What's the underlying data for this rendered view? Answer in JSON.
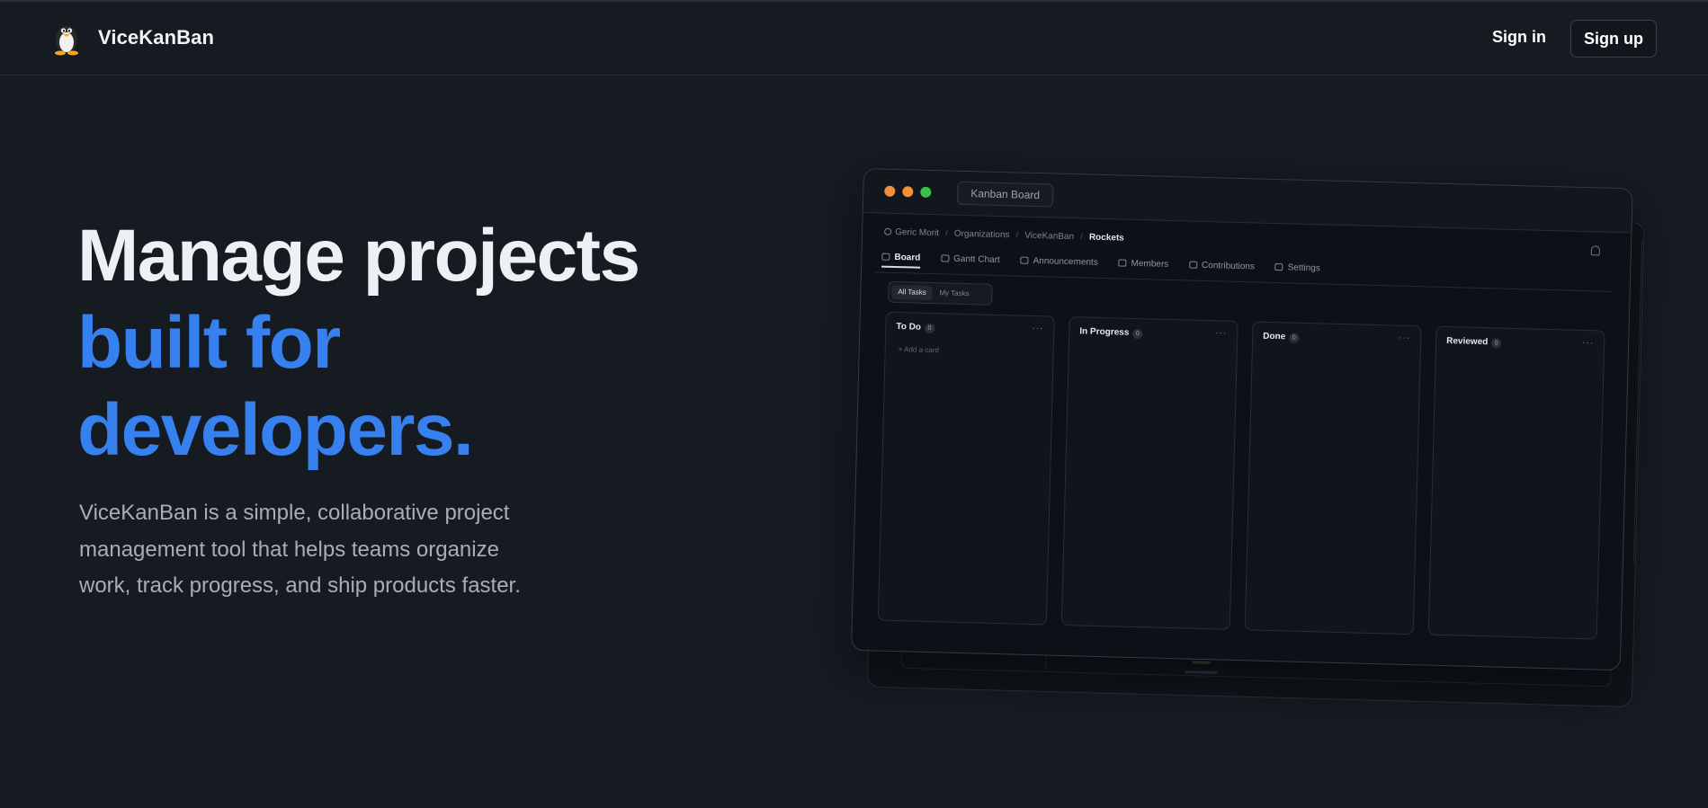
{
  "header": {
    "brand": "ViceKanBan",
    "sign_in": "Sign in",
    "sign_up": "Sign up",
    "logo_icon": "penguin-icon"
  },
  "hero": {
    "title_line1": "Manage projects",
    "title_line2": "built for",
    "title_line3": "developers.",
    "description": "ViceKanBan is a simple, collaborative project management tool that helps teams organize work, track progress, and ship products faster.",
    "accent_color": "#3680f0"
  },
  "mockup": {
    "window_tab": "Kanban Board",
    "breadcrumb": [
      "Geric Morit",
      "Organizations",
      "ViceKanBan",
      "Rockets"
    ],
    "nav": [
      "Board",
      "Gantt Chart",
      "Announcements",
      "Members",
      "Contributions",
      "Settings"
    ],
    "filters": [
      "All Tasks",
      "My Tasks"
    ],
    "columns": [
      {
        "title": "To Do",
        "count": "0",
        "more": "···",
        "add": "+ Add a card"
      },
      {
        "title": "In Progress",
        "count": "0",
        "more": "···"
      },
      {
        "title": "Done",
        "count": "0",
        "more": "···"
      },
      {
        "title": "Reviewed",
        "count": "0",
        "more": "···"
      }
    ]
  }
}
